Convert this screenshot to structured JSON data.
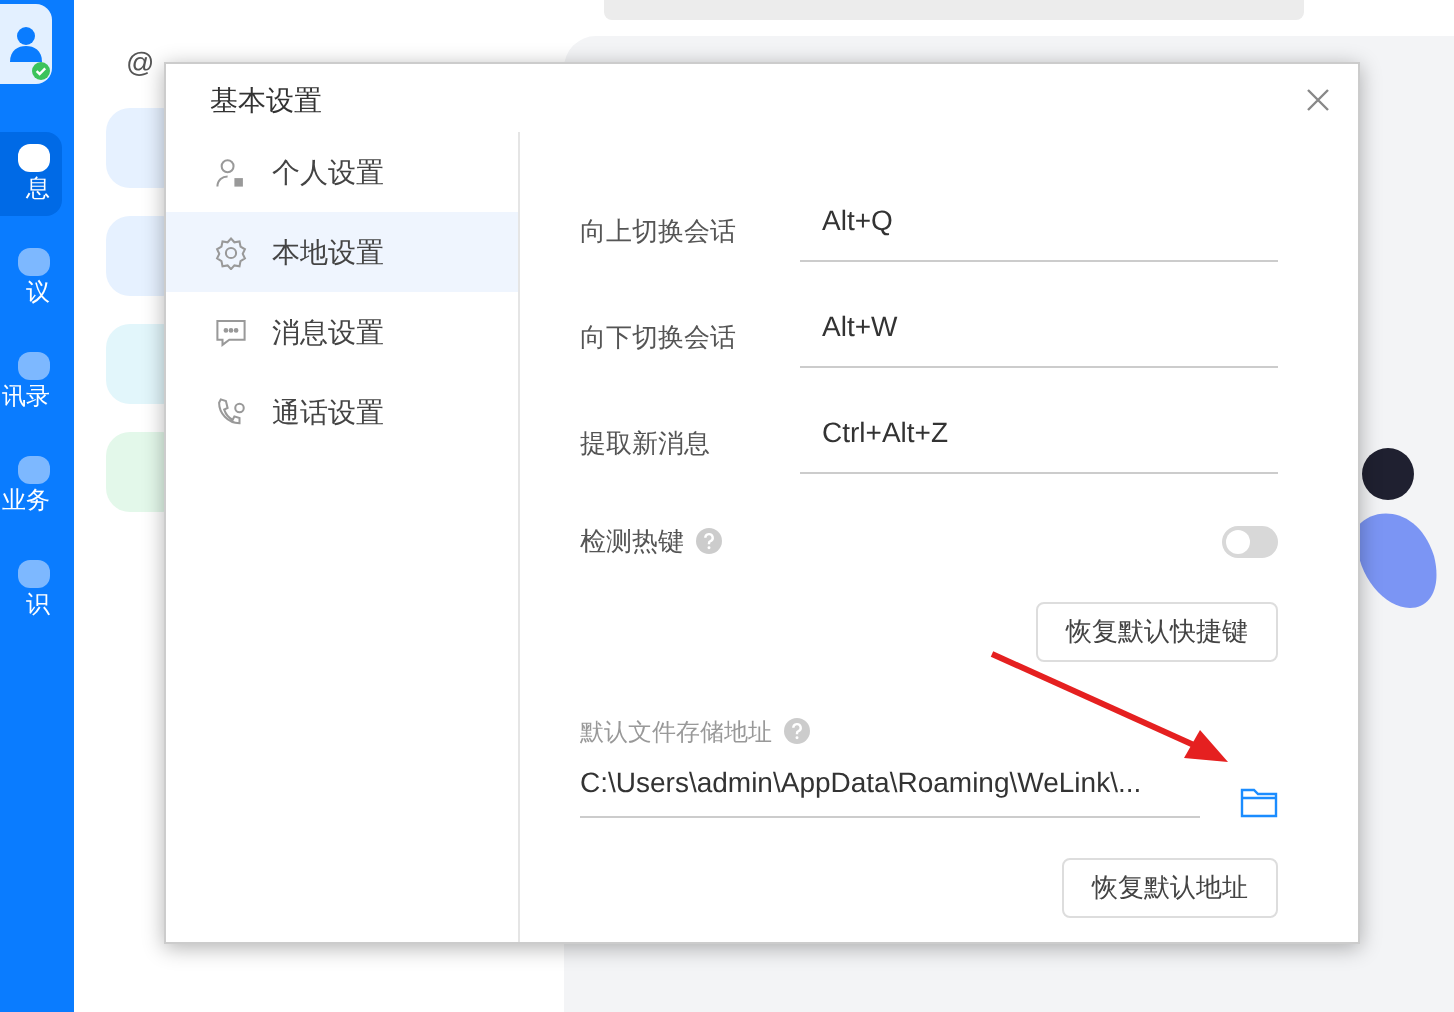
{
  "sidebar": {
    "items": [
      {
        "label": "息",
        "selected": true
      },
      {
        "label": "议",
        "selected": false
      },
      {
        "label": "讯录",
        "selected": false
      },
      {
        "label": "业务",
        "selected": false
      },
      {
        "label": "识",
        "selected": false
      }
    ]
  },
  "conversation_list": {
    "tab_label": "@"
  },
  "dialog": {
    "title": "基本设置",
    "nav": [
      {
        "label": "个人设置",
        "selected": false
      },
      {
        "label": "本地设置",
        "selected": true
      },
      {
        "label": "消息设置",
        "selected": false
      },
      {
        "label": "通话设置",
        "selected": false
      }
    ],
    "shortcuts": [
      {
        "label": "向上切换会话",
        "value": "Alt+Q"
      },
      {
        "label": "向下切换会话",
        "value": "Alt+W"
      },
      {
        "label": "提取新消息",
        "value": "Ctrl+Alt+Z"
      }
    ],
    "detect_hotkey": {
      "label": "检测热键",
      "on": false
    },
    "reset_shortcuts_button": "恢复默认快捷键",
    "storage": {
      "label": "默认文件存储地址",
      "path": "C:\\Users\\admin\\AppData\\Roaming\\WeLink\\..."
    },
    "reset_path_button": "恢复默认地址"
  }
}
